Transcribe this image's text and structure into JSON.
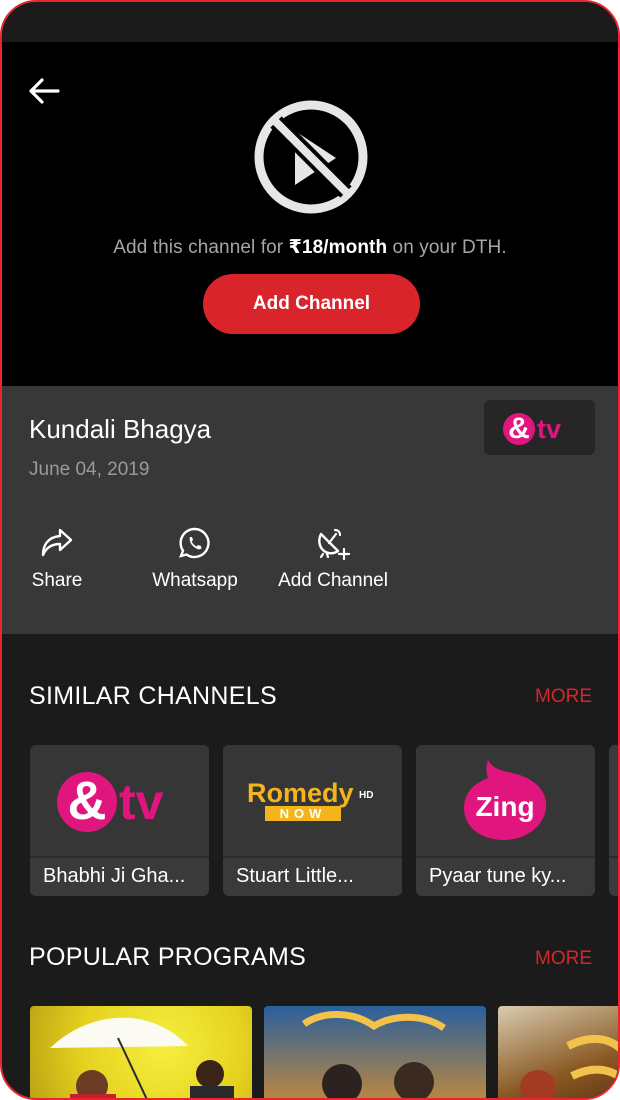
{
  "player": {
    "message_prefix": "Add this channel for ",
    "price": "₹18/month",
    "message_suffix": " on your DTH.",
    "cta_label": "Add Channel"
  },
  "program": {
    "title": "Kundali Bhagya",
    "date": "June 04, 2019",
    "channel_logo": "&tv"
  },
  "actions": [
    {
      "label": "Share",
      "icon": "share-icon"
    },
    {
      "label": "Whatsapp",
      "icon": "whatsapp-icon"
    },
    {
      "label": "Add Channel",
      "icon": "satellite-dish-add-icon"
    }
  ],
  "similar_channels": {
    "title": "SIMILAR CHANNELS",
    "more_label": "MORE",
    "items": [
      {
        "logo": "&tv",
        "label": "Bhabhi Ji Gha..."
      },
      {
        "logo": "Romedy NOW HD",
        "label": "Stuart Little..."
      },
      {
        "logo": "Zing",
        "label": "Pyaar tune ky..."
      }
    ]
  },
  "popular_programs": {
    "title": "POPULAR PROGRAMS",
    "more_label": "MORE"
  },
  "logos": {
    "andtv_amp": "&",
    "andtv_tv": "tv",
    "romedy_main": "Romedy",
    "romedy_now": "NOW",
    "romedy_hd": "HD",
    "zing": "Zing"
  },
  "colors": {
    "accent": "#d9242c",
    "background": "#1b1b1b",
    "info_panel": "#383838",
    "andtv_pink": "#e0167e"
  }
}
